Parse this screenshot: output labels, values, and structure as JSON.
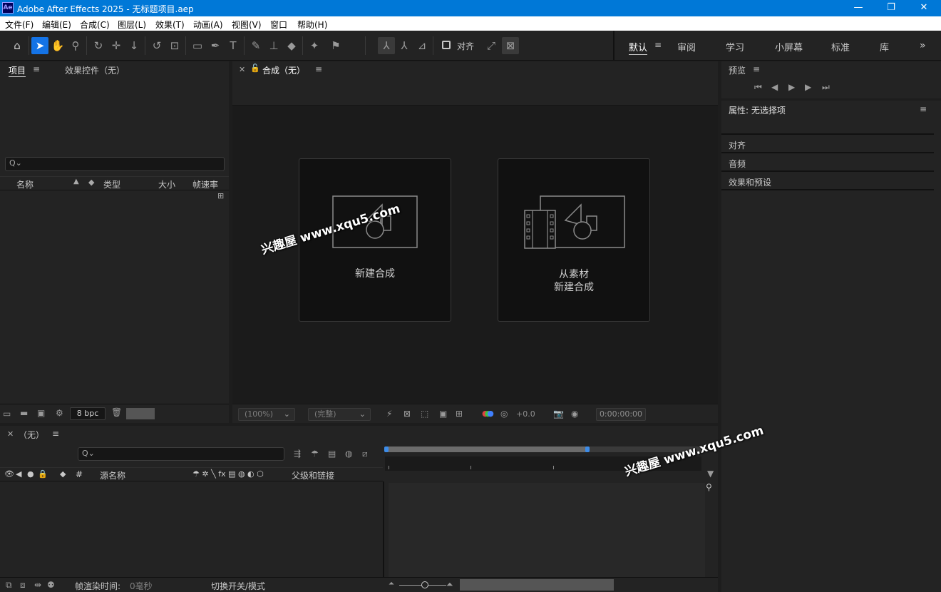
{
  "window": {
    "app_icon": "Ae",
    "title": "Adobe After Effects 2025 - 无标题项目.aep",
    "minimize": "—",
    "maximize": "❐",
    "close": "✕"
  },
  "menu": [
    "文件(F)",
    "编辑(E)",
    "合成(C)",
    "图层(L)",
    "效果(T)",
    "动画(A)",
    "视图(V)",
    "窗口",
    "帮助(H)"
  ],
  "toolbar": {
    "snap_label": "对齐",
    "workspaces": [
      "默认",
      "审阅",
      "学习",
      "小屏幕",
      "标准",
      "库"
    ],
    "active_workspace": "默认",
    "more": "»"
  },
  "project_panel": {
    "tab_project": "项目",
    "tab_effects": "效果控件（无）",
    "search_icon": "Q⌄",
    "columns": [
      "名称",
      "类型",
      "大小",
      "帧速率"
    ],
    "bpc": "8 bpc"
  },
  "composition_panel": {
    "tab": "合成（无）",
    "card_new_comp": "新建合成",
    "card_from_footage_line1": "从素材",
    "card_from_footage_line2": "新建合成",
    "zoom": "(100%)",
    "resolution": "(完整)",
    "exposure": "+0.0",
    "timecode": "0:00:00:00"
  },
  "right_panel": {
    "preview_tab": "预览",
    "properties_tab": "属性: 无选择项",
    "sections": [
      "对齐",
      "音频",
      "效果和预设"
    ]
  },
  "timeline": {
    "tab": "（无）",
    "col_hash": "#",
    "col_source": "源名称",
    "col_parent": "父级和链接",
    "render_time_label": "帧渲染时间:",
    "render_time_value": "0毫秒",
    "toggle_label": "切换开关/模式"
  },
  "watermark": "兴趣屋 www.xqu5.com"
}
